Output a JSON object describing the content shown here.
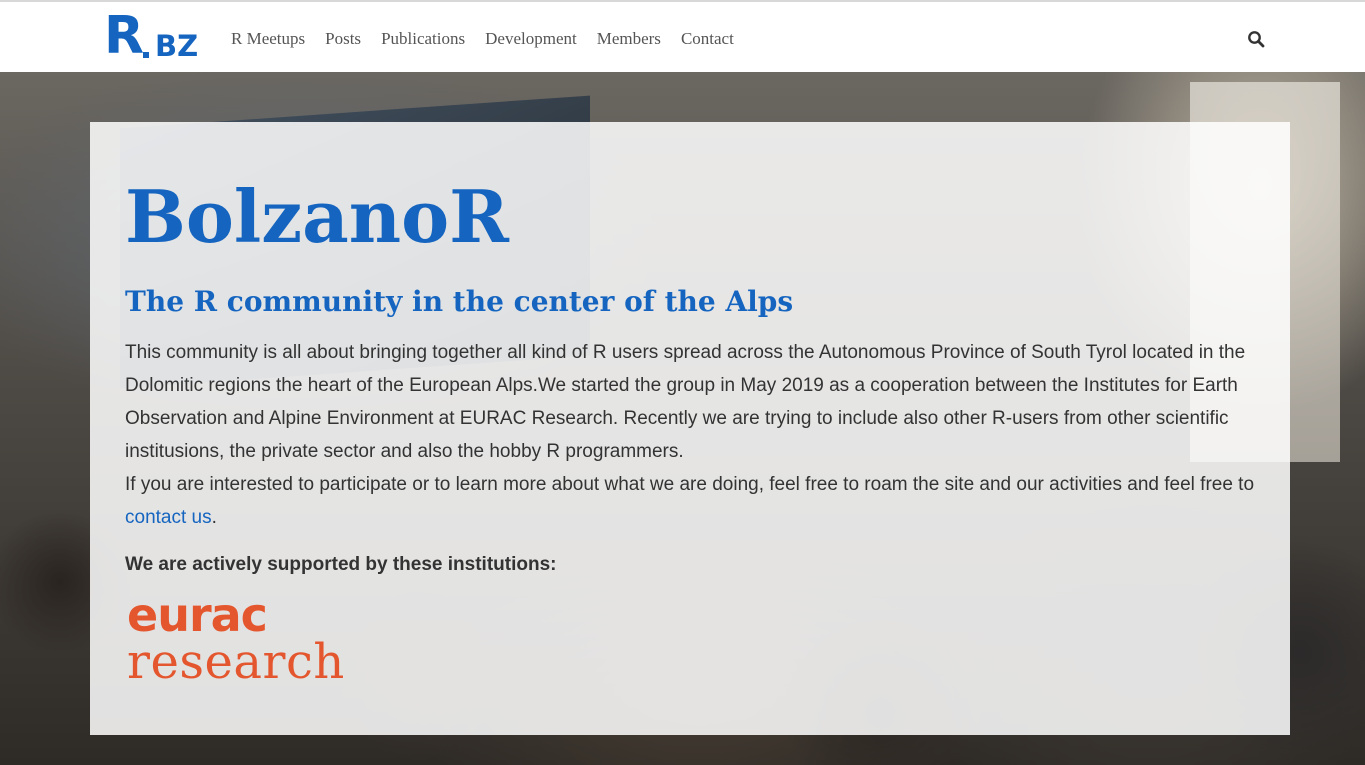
{
  "nav": {
    "logo_big": "R",
    "logo_small": "BZ",
    "links": [
      {
        "label": "R Meetups"
      },
      {
        "label": "Posts"
      },
      {
        "label": "Publications"
      },
      {
        "label": "Development"
      },
      {
        "label": "Members"
      },
      {
        "label": "Contact"
      }
    ],
    "search_icon": "search-icon"
  },
  "hero": {
    "title": "BolzanoR",
    "subtitle": "The R community in the center of the Alps",
    "paragraph1": "This community is all about bringing together all kind of R users spread across the Autonomous Province of South Tyrol located in the Dolomitic regions the heart of the European Alps.We started the group in May 2019 as a cooperation between the Institutes for Earth Observation and Alpine Environment at EURAC Research. Recently we are trying to include also other R-users from other scientific institusions, the private sector and also the hobby R programmers.",
    "paragraph2_before": "If you are interested to participate or to learn more about what we are doing, feel free to roam the site and our activities and feel free to ",
    "contact_link": "contact us",
    "paragraph2_after": ".",
    "supported_heading": "We are actively supported by these institutions:",
    "sponsor_logo": {
      "line1": "eurac",
      "line2": "research"
    }
  },
  "colors": {
    "accent": "#1565c0",
    "eurac": "#e4572e",
    "text": "#333333"
  }
}
